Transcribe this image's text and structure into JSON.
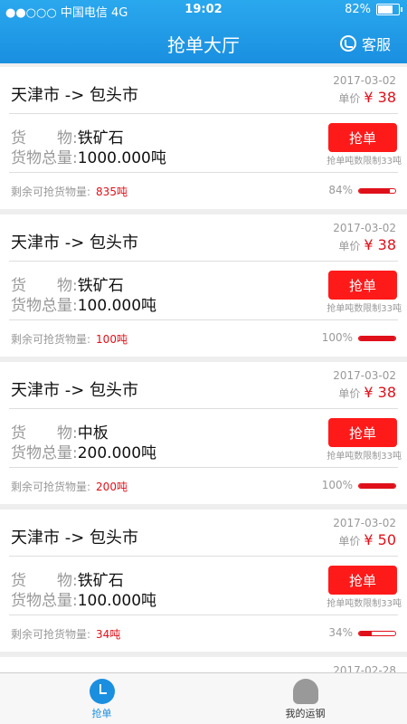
{
  "status": {
    "carrier": "●●○○○ 中国电信  4G",
    "time": "19:02",
    "battery": "82%",
    "battery_level": 0.82
  },
  "header": {
    "title": "抢单大厅",
    "service_label": "客服"
  },
  "labels": {
    "goods": "货　　物:",
    "total": "货物总量:",
    "remaining": "剩余可抢货物量:",
    "unit_price": "单价",
    "grab": "抢单",
    "limit": "抢单吨数限制33吨"
  },
  "orders": [
    {
      "route": "天津市 -> 包头市",
      "date": "2017-03-02",
      "price": "¥ 38",
      "goods": "铁矿石",
      "total": "1000.000吨",
      "remaining": "835吨",
      "percent_text": "84%",
      "percent": 84
    },
    {
      "route": "天津市 -> 包头市",
      "date": "2017-03-02",
      "price": "¥ 38",
      "goods": "铁矿石",
      "total": "100.000吨",
      "remaining": "100吨",
      "percent_text": "100%",
      "percent": 100
    },
    {
      "route": "天津市 -> 包头市",
      "date": "2017-03-02",
      "price": "¥ 38",
      "goods": "中板",
      "total": "200.000吨",
      "remaining": "200吨",
      "percent_text": "100%",
      "percent": 100
    },
    {
      "route": "天津市 -> 包头市",
      "date": "2017-03-02",
      "price": "¥ 50",
      "goods": "铁矿石",
      "total": "100.000吨",
      "remaining": "34吨",
      "percent_text": "34%",
      "percent": 34
    },
    {
      "date": "2017-02-28"
    }
  ],
  "tabs": [
    {
      "label": "抢单",
      "icon": "clock-icon",
      "active": true
    },
    {
      "label": "我的运钢",
      "icon": "user-icon",
      "active": false
    }
  ]
}
